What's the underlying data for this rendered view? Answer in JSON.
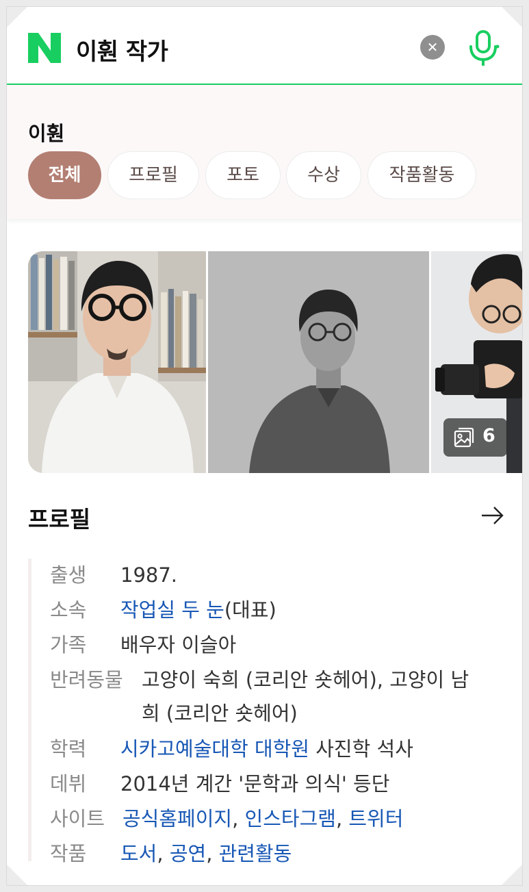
{
  "search": {
    "query": "이훤 작가",
    "logo_letter": "N",
    "clear_icon": "close-icon",
    "voice_icon": "microphone-icon",
    "accent_color": "#19ce60"
  },
  "entity": {
    "name": "이훤",
    "tabs": [
      {
        "label": "전체",
        "active": true
      },
      {
        "label": "프로필",
        "active": false
      },
      {
        "label": "포토",
        "active": false
      },
      {
        "label": "수상",
        "active": false
      },
      {
        "label": "작품활동",
        "active": false
      }
    ],
    "active_color": "#b37f72"
  },
  "photos": {
    "count": "6",
    "count_icon": "photo-gallery-icon"
  },
  "profile": {
    "heading": "프로필",
    "more_icon": "arrow-right-icon",
    "rows": [
      {
        "label": "출생",
        "text": "1987."
      },
      {
        "label": "소속",
        "link": "작업실 두 눈",
        "suffix": "(대표)"
      },
      {
        "label": "가족",
        "text": "배우자 이슬아"
      },
      {
        "label": "반려동물",
        "line1": "고양이 숙희 (코리안 숏헤어), 고양이 남",
        "line2": "희 (코리안 숏헤어)"
      },
      {
        "label": "학력",
        "link": "시카고예술대학 대학원",
        "suffix": " 사진학 석사"
      },
      {
        "label": "데뷔",
        "text": "2014년 계간 '문학과 의식' 등단"
      },
      {
        "label": "사이트",
        "links": [
          "공식홈페이지",
          "인스타그램",
          "트위터"
        ]
      },
      {
        "label": "작품",
        "links": [
          "도서",
          "공연",
          "관련활동"
        ]
      }
    ],
    "link_color": "#1757b5"
  }
}
